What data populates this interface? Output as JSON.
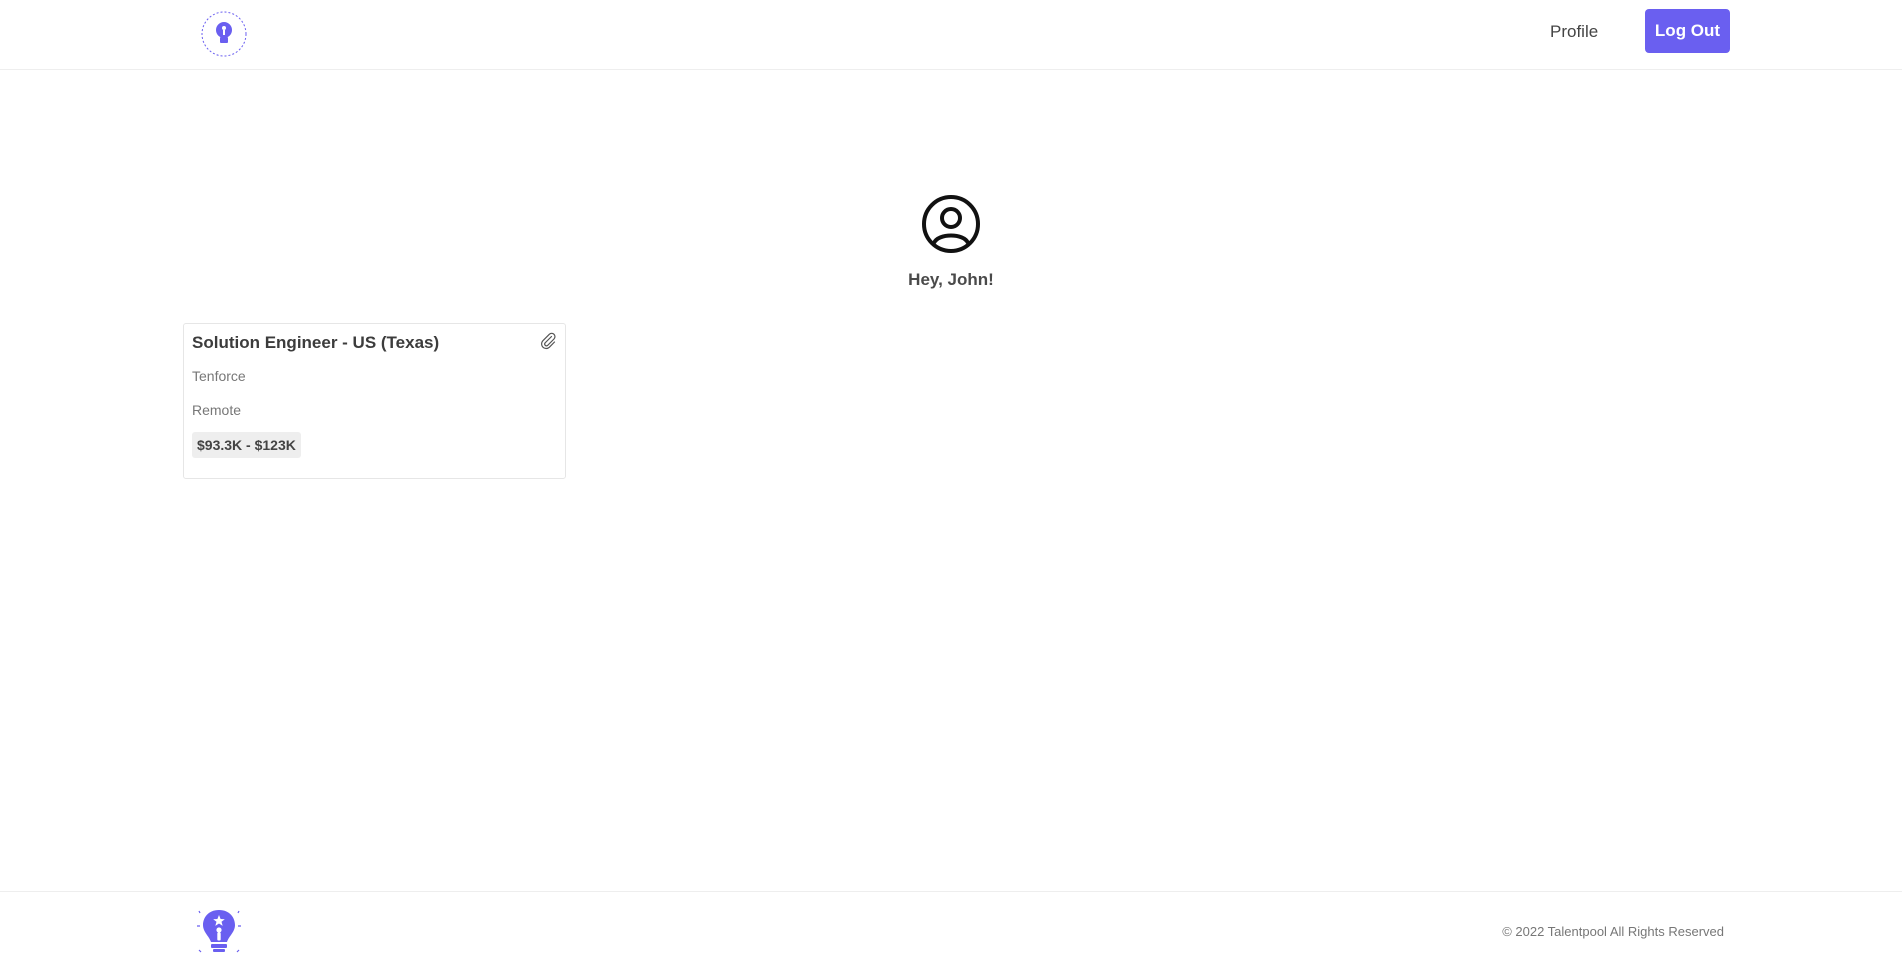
{
  "header": {
    "logo_icon": "talentpool-logo-icon",
    "nav": {
      "profile_label": "Profile",
      "logout_label": "Log Out"
    }
  },
  "main": {
    "avatar_icon": "user-circle-icon",
    "greeting": "Hey, John!",
    "jobs": [
      {
        "title": "Solution Engineer - US (Texas)",
        "company": "Tenforce",
        "location": "Remote",
        "salary": "$93.3K - $123K",
        "action_icon": "paperclip-icon"
      }
    ]
  },
  "footer": {
    "logo_icon": "lightbulb-logo-icon",
    "copyright": "© 2022 Talentpool All Rights Reserved"
  },
  "colors": {
    "accent": "#6a5ff0",
    "text": "#3a3a3a",
    "muted": "#777777",
    "border": "#eeeeee"
  }
}
